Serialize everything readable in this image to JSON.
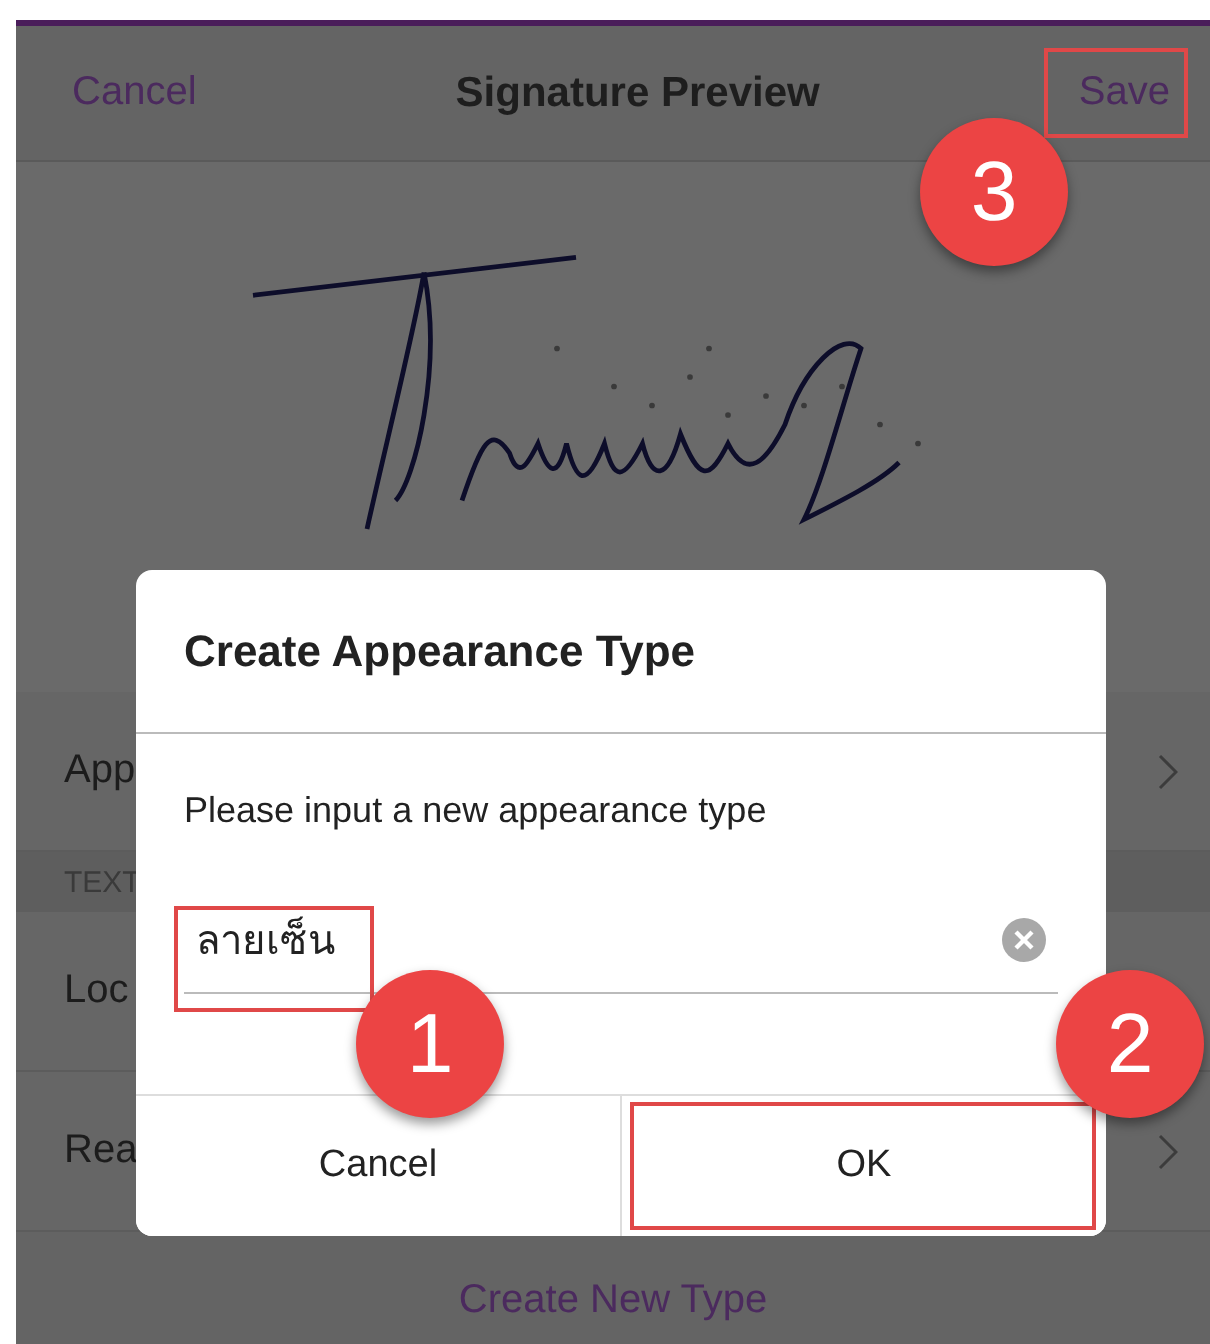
{
  "header": {
    "cancel": "Cancel",
    "title": "Signature Preview",
    "save": "Save",
    "save_highlighted": true,
    "save_badge": "3"
  },
  "list": [
    {
      "kind": "row",
      "label": "App",
      "chevron": true
    },
    {
      "kind": "section",
      "label": "TEXT"
    },
    {
      "kind": "row",
      "label": "Loc",
      "chevron": false
    },
    {
      "kind": "row",
      "label": "Rea",
      "chevron": true
    }
  ],
  "create_button": "Create New Type",
  "dialog": {
    "title": "Create Appearance Type",
    "prompt": "Please input a new appearance type",
    "input_value": "ลายเซ็น",
    "input_highlighted": true,
    "input_badge": "1",
    "buttons": [
      {
        "label": "Cancel",
        "highlighted": false
      },
      {
        "label": "OK",
        "highlighted": true,
        "badge": "2"
      }
    ]
  }
}
